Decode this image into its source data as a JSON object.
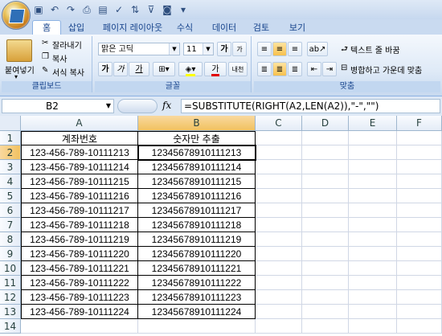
{
  "quick_access": {
    "icons": [
      "save-icon",
      "undo-icon",
      "redo-icon",
      "print-icon",
      "preview-icon",
      "spell-icon",
      "sort-icon",
      "filter-icon",
      "camera-icon",
      "dropdown-icon"
    ]
  },
  "tabs": [
    "홈",
    "삽입",
    "페이지 레이아웃",
    "수식",
    "데이터",
    "검토",
    "보기"
  ],
  "ribbon": {
    "clipboard": {
      "paste": "붙여넣기",
      "cut": "잘라내기",
      "copy": "복사",
      "format_painter": "서식 복사",
      "label": "클립보드"
    },
    "font": {
      "name": "맑은 고딕",
      "size": "11",
      "grow": "가",
      "label": "글꼴",
      "bold": "가",
      "italic": "가",
      "underline": "가",
      "font_color": "가",
      "phonetic": "내천"
    },
    "alignment": {
      "wrap_text": "텍스트 줄 바꿈",
      "merge_center": "병합하고 가운데 맞춤",
      "label": "맞춤"
    }
  },
  "formula_bar": {
    "name_box": "B2",
    "fx": "fx",
    "formula": "=SUBSTITUTE(RIGHT(A2,LEN(A2)),\"-\",\"\")"
  },
  "columns": [
    "A",
    "B",
    "C",
    "D",
    "E",
    "F"
  ],
  "rows": [
    {
      "n": "1",
      "a": "계좌번호",
      "b": "숫자만 추출"
    },
    {
      "n": "2",
      "a": "123-456-789-10111213",
      "b": "12345678910111213"
    },
    {
      "n": "3",
      "a": "123-456-789-10111214",
      "b": "12345678910111214"
    },
    {
      "n": "4",
      "a": "123-456-789-10111215",
      "b": "12345678910111215"
    },
    {
      "n": "5",
      "a": "123-456-789-10111216",
      "b": "12345678910111216"
    },
    {
      "n": "6",
      "a": "123-456-789-10111217",
      "b": "12345678910111217"
    },
    {
      "n": "7",
      "a": "123-456-789-10111218",
      "b": "12345678910111218"
    },
    {
      "n": "8",
      "a": "123-456-789-10111219",
      "b": "12345678910111219"
    },
    {
      "n": "9",
      "a": "123-456-789-10111220",
      "b": "12345678910111220"
    },
    {
      "n": "10",
      "a": "123-456-789-10111221",
      "b": "12345678910111221"
    },
    {
      "n": "11",
      "a": "123-456-789-10111222",
      "b": "12345678910111222"
    },
    {
      "n": "12",
      "a": "123-456-789-10111223",
      "b": "12345678910111223"
    },
    {
      "n": "13",
      "a": "123-456-789-10111224",
      "b": "12345678910111224"
    },
    {
      "n": "14",
      "a": "",
      "b": ""
    }
  ]
}
